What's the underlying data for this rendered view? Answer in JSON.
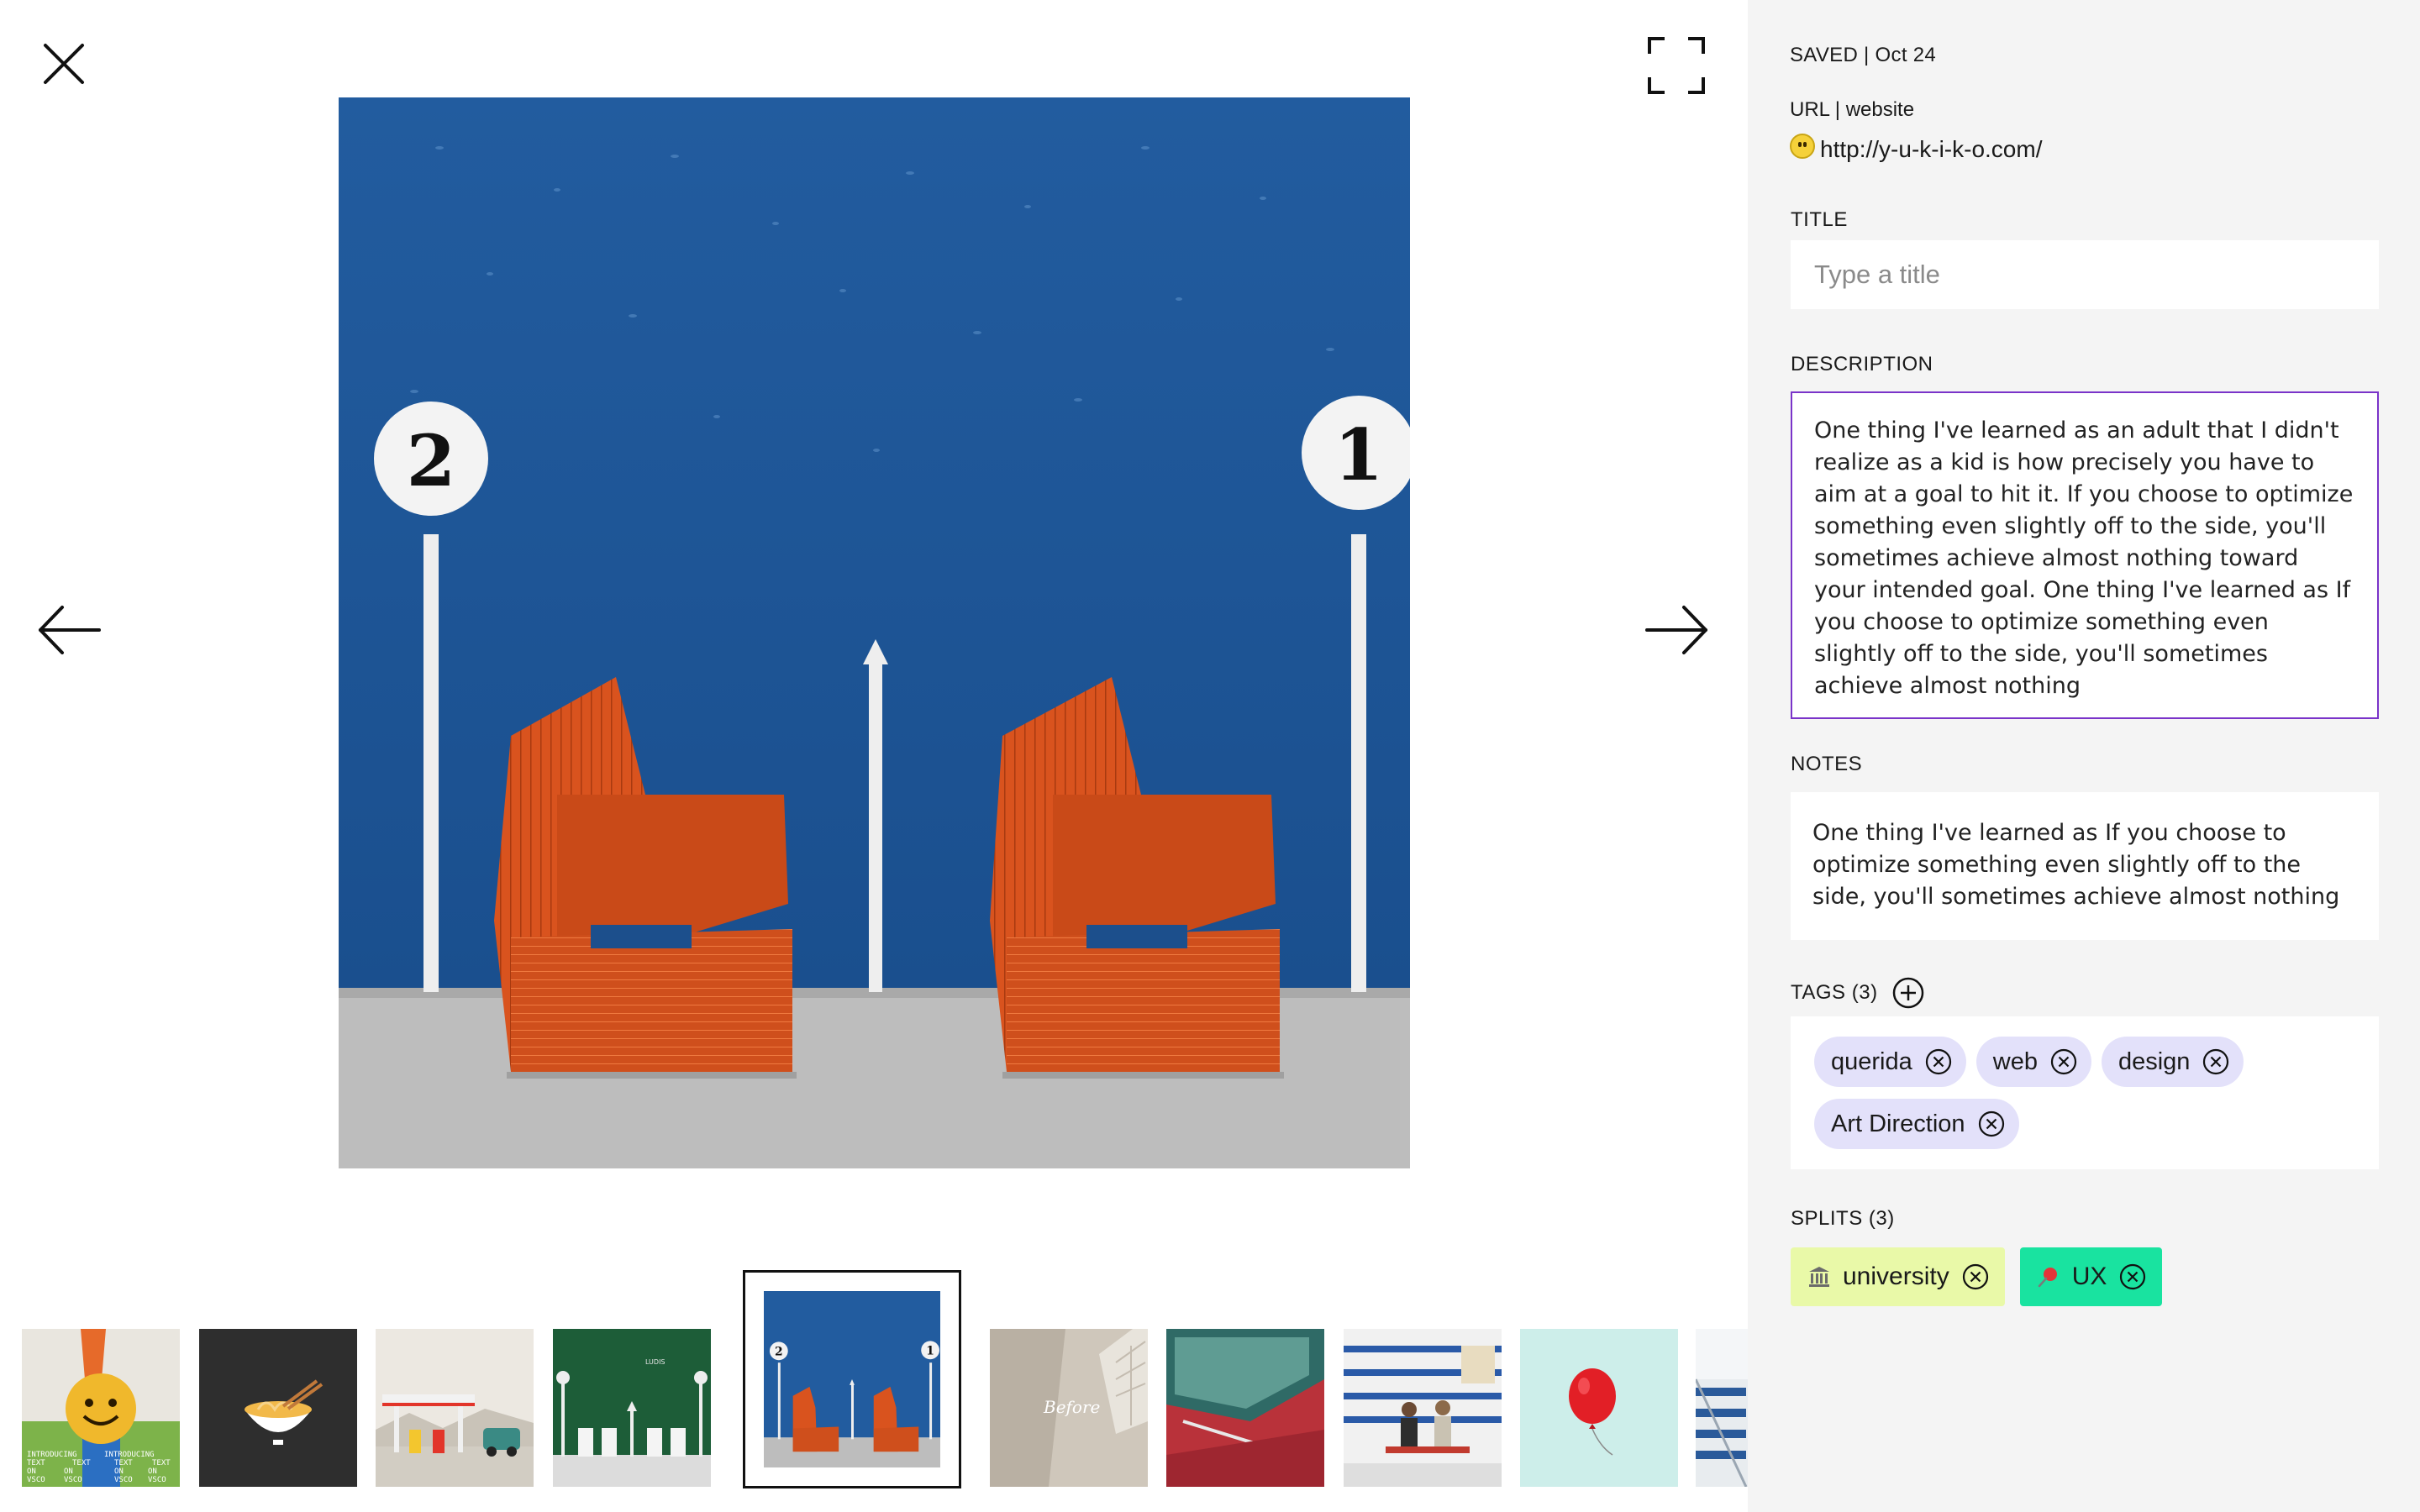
{
  "viewer": {
    "icons": {
      "close": "close-icon",
      "fullscreen": "fullscreen-icon",
      "prev": "arrow-left-icon",
      "next": "arrow-right-icon"
    },
    "main_image": {
      "number_left": "2",
      "number_right": "1",
      "wall_color": "#1f5a9e",
      "chair_color": "#d9531e"
    }
  },
  "filmstrip": {
    "thumbnails": [
      {
        "name": "smiley-ball",
        "texts": [
          "INTRODUCING",
          "INTRODUCING",
          "TEXT",
          "TEXT",
          "TEXT",
          "TEXT",
          "ON",
          "ON",
          "ON",
          "ON",
          "VSCO",
          "VSCO",
          "VSCO",
          "VSCO"
        ]
      },
      {
        "name": "noodle-bowl"
      },
      {
        "name": "gas-station"
      },
      {
        "name": "green-wall-chairs",
        "caption": "LUDIS"
      },
      {
        "name": "blue-wall-chairs",
        "active": true,
        "number_left": "2",
        "number_right": "1"
      },
      {
        "name": "before-room",
        "caption": "Before"
      },
      {
        "name": "red-car"
      },
      {
        "name": "people-bench"
      },
      {
        "name": "balloon"
      },
      {
        "name": "building"
      }
    ]
  },
  "panel": {
    "saved": "SAVED | Oct 24",
    "url_label": "URL | website",
    "url": "http://y-u-k-i-k-o.com/",
    "title_label": "TITLE",
    "title_placeholder": "Type a title",
    "description_label": "DESCRIPTION",
    "description": "One thing I've learned as an adult that I didn't realize as a kid is how precisely you have to aim at a goal to hit it. If you choose to optimize something even slightly off to the side, you'll sometimes achieve almost nothing toward your intended goal. One thing I've learned as If you choose to optimize something even slightly off to the side, you'll sometimes achieve almost nothing",
    "notes_label": "NOTES",
    "notes": "One thing I've learned as If you choose to optimize something even slightly off to the side, you'll sometimes achieve almost nothing",
    "tags_label": "TAGS (3)",
    "tags": [
      "querida",
      "web",
      "design",
      "Art Direction"
    ],
    "splits_label": "SPLITS (3)",
    "splits": [
      {
        "label": "university",
        "icon": "bank-icon",
        "color": "#e9f9a8"
      },
      {
        "label": "UX",
        "icon": "pushpin-icon",
        "color": "#19e3a0"
      }
    ],
    "accent_color": "#7a33c9"
  }
}
